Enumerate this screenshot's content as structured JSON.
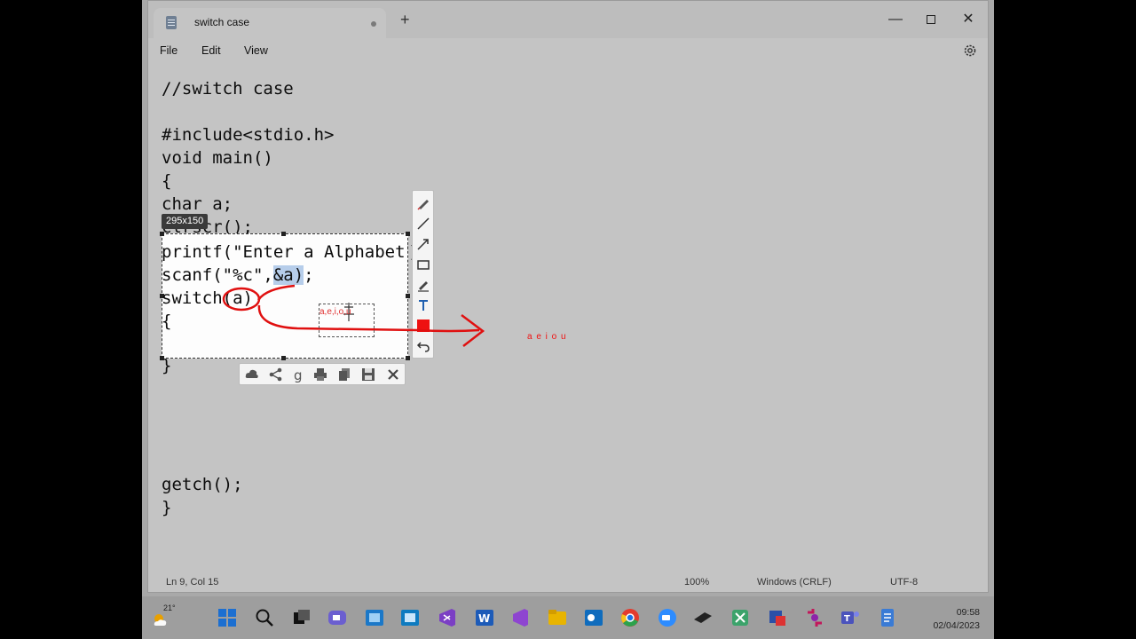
{
  "window": {
    "tab_title": "switch case",
    "new_tab": "+",
    "minimize": "—",
    "close": "✕"
  },
  "menu": {
    "file": "File",
    "edit": "Edit",
    "view": "View"
  },
  "editor": {
    "lines": [
      "//switch case",
      "",
      "#include<stdio.h>",
      "void main()",
      "{",
      "char a;",
      "clrscr();",
      "printf(\"Enter a Alphabet\");",
      "scanf(\"%c\",&a);",
      "switch(a)",
      "{",
      "",
      "}",
      "",
      "",
      "",
      "",
      "getch();",
      "}"
    ],
    "scanf_prefix": "scanf(\"%c\",",
    "scanf_selected": "&a)",
    "scanf_suffix": ";"
  },
  "status": {
    "position": "Ln 9, Col 15",
    "zoom": "100%",
    "line_ending": "Windows (CRLF)",
    "encoding": "UTF-8"
  },
  "snip": {
    "dimensions": "295x150",
    "annotation_inside": "a,e,i,o,u",
    "annotation_outside": "a e i o u",
    "pen_color": "#e01010"
  },
  "taskbar": {
    "temperature": "21°",
    "time": "09:58",
    "date": "02/04/2023"
  }
}
